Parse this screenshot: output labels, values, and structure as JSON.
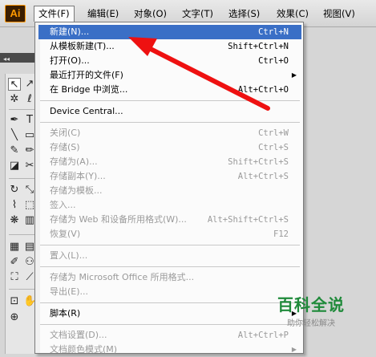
{
  "app": {
    "logo": "Ai"
  },
  "menubar": {
    "items": [
      {
        "label": "文件(F)",
        "active": true
      },
      {
        "label": "编辑(E)"
      },
      {
        "label": "对象(O)"
      },
      {
        "label": "文字(T)"
      },
      {
        "label": "选择(S)"
      },
      {
        "label": "效果(C)"
      },
      {
        "label": "视图(V)"
      }
    ]
  },
  "panel": {
    "collapse_glyph": "◂◂"
  },
  "tools": [
    {
      "icon": "selection-tool-icon",
      "glyph": "↖"
    },
    {
      "icon": "direct-selection-tool-icon",
      "glyph": "↗"
    },
    {
      "icon": "magic-wand-tool-icon",
      "glyph": "✲"
    },
    {
      "icon": "lasso-tool-icon",
      "glyph": "ℓ"
    },
    {
      "icon": "pen-tool-icon",
      "glyph": "✒"
    },
    {
      "icon": "type-tool-icon",
      "glyph": "T"
    },
    {
      "icon": "line-tool-icon",
      "glyph": "╲"
    },
    {
      "icon": "rectangle-tool-icon",
      "glyph": "▭"
    },
    {
      "icon": "brush-tool-icon",
      "glyph": "✎"
    },
    {
      "icon": "pencil-tool-icon",
      "glyph": "✏"
    },
    {
      "icon": "eraser-tool-icon",
      "glyph": "◪"
    },
    {
      "icon": "scissors-tool-icon",
      "glyph": "✂"
    },
    {
      "icon": "rotate-tool-icon",
      "glyph": "↻"
    },
    {
      "icon": "scale-tool-icon",
      "glyph": "⤡"
    },
    {
      "icon": "warp-tool-icon",
      "glyph": "⌇"
    },
    {
      "icon": "free-transform-tool-icon",
      "glyph": "⬚"
    },
    {
      "icon": "symbol-sprayer-tool-icon",
      "glyph": "❋"
    },
    {
      "icon": "graph-tool-icon",
      "glyph": "▥"
    },
    {
      "icon": "mesh-tool-icon",
      "glyph": "▦"
    },
    {
      "icon": "gradient-tool-icon",
      "glyph": "▤"
    },
    {
      "icon": "eyedropper-tool-icon",
      "glyph": "✐"
    },
    {
      "icon": "blend-tool-icon",
      "glyph": "⚇"
    },
    {
      "icon": "live-paint-tool-icon",
      "glyph": "⛶"
    },
    {
      "icon": "slice-tool-icon",
      "glyph": "⟋"
    },
    {
      "icon": "artboard-tool-icon",
      "glyph": "⊡"
    },
    {
      "icon": "hand-tool-icon",
      "glyph": "✋"
    },
    {
      "icon": "zoom-tool-icon",
      "glyph": "⊕"
    }
  ],
  "file_menu": {
    "items": [
      {
        "label": "新建(N)...",
        "shortcut": "Ctrl+N",
        "highlighted": true
      },
      {
        "label": "从模板新建(T)...",
        "shortcut": "Shift+Ctrl+N"
      },
      {
        "label": "打开(O)...",
        "shortcut": "Ctrl+O"
      },
      {
        "label": "最近打开的文件(F)",
        "submenu": true
      },
      {
        "label": "在 Bridge 中浏览...",
        "shortcut": "Alt+Ctrl+O"
      },
      {
        "separator": true
      },
      {
        "label": "Device Central..."
      },
      {
        "separator": true
      },
      {
        "label": "关闭(C)",
        "shortcut": "Ctrl+W",
        "disabled": true
      },
      {
        "label": "存储(S)",
        "shortcut": "Ctrl+S",
        "disabled": true
      },
      {
        "label": "存储为(A)...",
        "shortcut": "Shift+Ctrl+S",
        "disabled": true
      },
      {
        "label": "存储副本(Y)...",
        "shortcut": "Alt+Ctrl+S",
        "disabled": true
      },
      {
        "label": "存储为模板...",
        "disabled": true
      },
      {
        "label": "签入...",
        "disabled": true
      },
      {
        "label": "存储为 Web 和设备所用格式(W)...",
        "shortcut": "Alt+Shift+Ctrl+S",
        "disabled": true
      },
      {
        "label": "恢复(V)",
        "shortcut": "F12",
        "disabled": true
      },
      {
        "separator": true
      },
      {
        "label": "置入(L)...",
        "disabled": true
      },
      {
        "separator": true
      },
      {
        "label": "存储为 Microsoft Office 所用格式...",
        "disabled": true
      },
      {
        "label": "导出(E)...",
        "disabled": true
      },
      {
        "separator": true
      },
      {
        "label": "脚本(R)",
        "submenu": true
      },
      {
        "separator": true
      },
      {
        "label": "文档设置(D)...",
        "shortcut": "Alt+Ctrl+P",
        "disabled": true
      },
      {
        "label": "文档颜色模式(M)",
        "submenu": true,
        "disabled": true
      }
    ]
  },
  "annotation": {
    "arrow_color": "#ee1111"
  },
  "watermark": {
    "title": "百科全说",
    "subtitle": "助你轻松解决"
  },
  "colors": {
    "highlight": "#3a6fc6",
    "disabled_text": "#9a9a9a",
    "watermark_green": "#1f8a3a"
  }
}
